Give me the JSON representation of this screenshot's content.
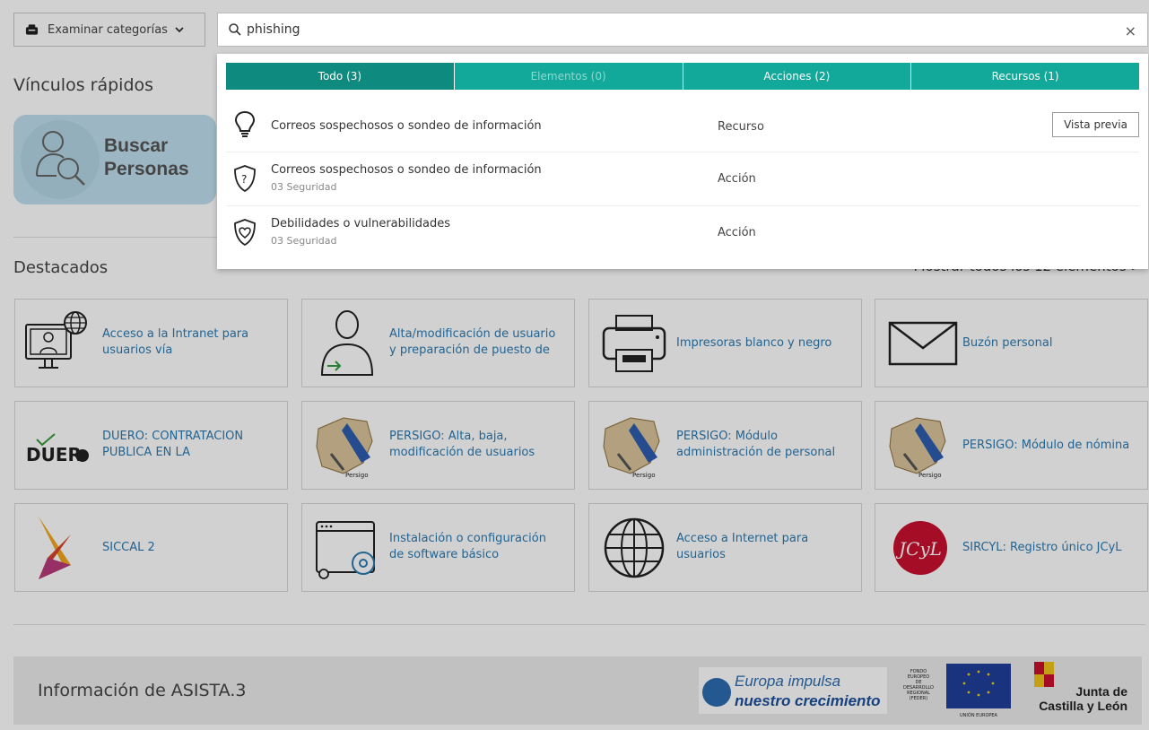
{
  "browse_button": {
    "label": "Examinar categorías"
  },
  "quick_links": {
    "title": "Vínculos rápidos",
    "search_people_lines": [
      "Buscar",
      "Personas"
    ]
  },
  "featured": {
    "title": "Destacados",
    "show_all": "Mostrar todos los 12 elementos >"
  },
  "cards": [
    {
      "lines": [
        "Acceso a la Intranet para",
        "usuarios vía"
      ],
      "icon": "intranet-globe-user-icon"
    },
    {
      "lines": [
        "Alta/modificación de usuario",
        "y preparación de puesto de"
      ],
      "icon": "user-add-icon"
    },
    {
      "lines": [
        "Impresoras blanco y negro"
      ],
      "icon": "printer-icon"
    },
    {
      "lines": [
        "Buzón personal"
      ],
      "icon": "envelope-icon"
    },
    {
      "lines": [
        "DUERO: CONTRATACION",
        "PUBLICA EN LA"
      ],
      "icon": "duero-logo-icon",
      "logo_text": "DUER"
    },
    {
      "lines": [
        "PERSIGO: Alta, baja,",
        "modificación de usuarios"
      ],
      "icon": "persigo-map-icon",
      "logo_text": "Persigo"
    },
    {
      "lines": [
        "PERSIGO: Módulo",
        "administración de personal"
      ],
      "icon": "persigo-map-icon",
      "logo_text": "Persigo"
    },
    {
      "lines": [
        "PERSIGO: Módulo de nómina"
      ],
      "icon": "persigo-map-icon",
      "logo_text": "Persigo"
    },
    {
      "lines": [
        "SICCAL 2"
      ],
      "icon": "siccal-logo-icon"
    },
    {
      "lines": [
        "Instalación o configuración",
        "de software básico"
      ],
      "icon": "software-install-icon"
    },
    {
      "lines": [
        "Acceso a Internet para",
        "usuarios"
      ],
      "icon": "globe-icon"
    },
    {
      "lines": [
        "SIRCYL: Registro único JCyL"
      ],
      "icon": "jcyl-logo-icon",
      "logo_text": "JCyL"
    }
  ],
  "footer": {
    "info": "Información de ASISTA.3",
    "europa_text": "Europa impulsa",
    "europa_text2": "nuestro crecimiento",
    "fondo_lines": [
      "FONDO",
      "EUROPEO",
      "DE",
      "DESARROLLO",
      "REGIONAL",
      "(FEDER)"
    ],
    "ue_label": "UNIÓN EUROPEA",
    "junta_lines": [
      "Junta de",
      "Castilla y León"
    ]
  },
  "search": {
    "value": "phishing"
  },
  "tabs": [
    {
      "label": "Todo (3)",
      "state": "active"
    },
    {
      "label": "Elementos (0)",
      "state": "disabled"
    },
    {
      "label": "Acciones (2)",
      "state": "normal"
    },
    {
      "label": "Recursos (1)",
      "state": "normal"
    }
  ],
  "results": [
    {
      "title": "Correos sospechosos o sondeo de información",
      "subtitle": "",
      "type": "Recurso",
      "icon": "lightbulb-icon",
      "preview": "Vista previa"
    },
    {
      "title": "Correos sospechosos o sondeo de información",
      "subtitle": "03 Seguridad",
      "type": "Acción",
      "icon": "shield-question-icon"
    },
    {
      "title": "Debilidades o vulnerabilidades",
      "subtitle": "03 Seguridad",
      "type": "Acción",
      "icon": "shield-heart-icon"
    }
  ],
  "colors": {
    "teal": "#12a89a",
    "teal_active": "#0e8a7f",
    "link_blue": "#2a7ab3"
  }
}
